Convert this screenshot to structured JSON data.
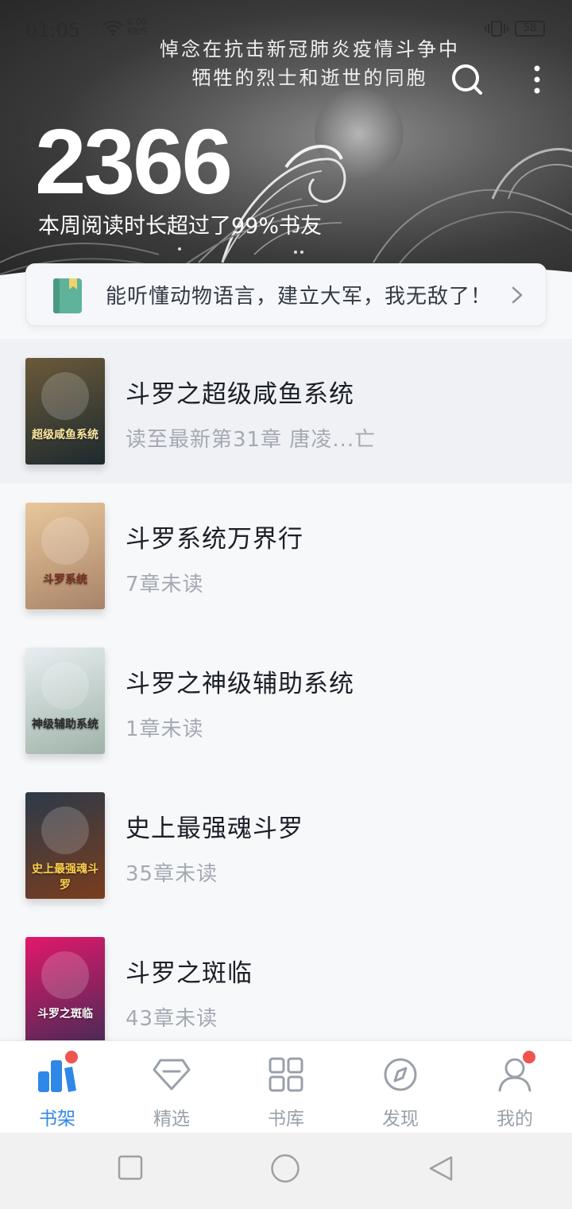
{
  "status_bar": {
    "time": "01:05",
    "net_speed_value": "0.00",
    "net_speed_unit": "KB/S",
    "battery": "58"
  },
  "header": {
    "memorial_line1": "悼念在抗击新冠肺炎疫情斗争中",
    "memorial_line2": "牺牲的烈士和逝世的同胞",
    "reading_minutes": "2366",
    "reading_stat": "本周阅读时长超过了99%书友"
  },
  "recommendation": {
    "text": "能听懂动物语言，建立大军，我无敌了！"
  },
  "books": [
    {
      "title": "斗罗之超级咸鱼系统",
      "subtitle": "读至最新第31章 唐凌...亡",
      "cover_text": "超级咸鱼系统",
      "cover_top": "#6b5a3a",
      "cover_bottom": "#1d2a2e",
      "cover_text_color": "#ffe7a0"
    },
    {
      "title": "斗罗系统万界行",
      "subtitle": "7章未读",
      "cover_text": "斗罗系统",
      "cover_top": "#e9c79b",
      "cover_bottom": "#a88369",
      "cover_text_color": "#7a2f1c"
    },
    {
      "title": "斗罗之神级辅助系统",
      "subtitle": "1章未读",
      "cover_text": "神级辅助系统",
      "cover_top": "#e8eef2",
      "cover_bottom": "#9fb3a8",
      "cover_text_color": "#2b2b2b"
    },
    {
      "title": "史上最强魂斗罗",
      "subtitle": "35章未读",
      "cover_text": "史上最强魂斗罗",
      "cover_top": "#2c3a4a",
      "cover_bottom": "#7a3d1d",
      "cover_text_color": "#ffd24a"
    },
    {
      "title": "斗罗之斑临",
      "subtitle": "43章未读",
      "cover_text": "斗罗之斑临",
      "cover_top": "#e2186c",
      "cover_bottom": "#4a2a55",
      "cover_text_color": "#ffffff"
    }
  ],
  "tabs": [
    {
      "label": "书架",
      "icon": "bookshelf-icon",
      "active": true,
      "badge": true
    },
    {
      "label": "精选",
      "icon": "diamond-icon",
      "active": false,
      "badge": false
    },
    {
      "label": "书库",
      "icon": "grid-icon",
      "active": false,
      "badge": false
    },
    {
      "label": "发现",
      "icon": "compass-icon",
      "active": false,
      "badge": false
    },
    {
      "label": "我的",
      "icon": "user-icon",
      "active": false,
      "badge": true
    }
  ],
  "colors": {
    "accent": "#2f87e8",
    "badge": "#f0544f",
    "tab_inactive": "#9aa0aa"
  }
}
